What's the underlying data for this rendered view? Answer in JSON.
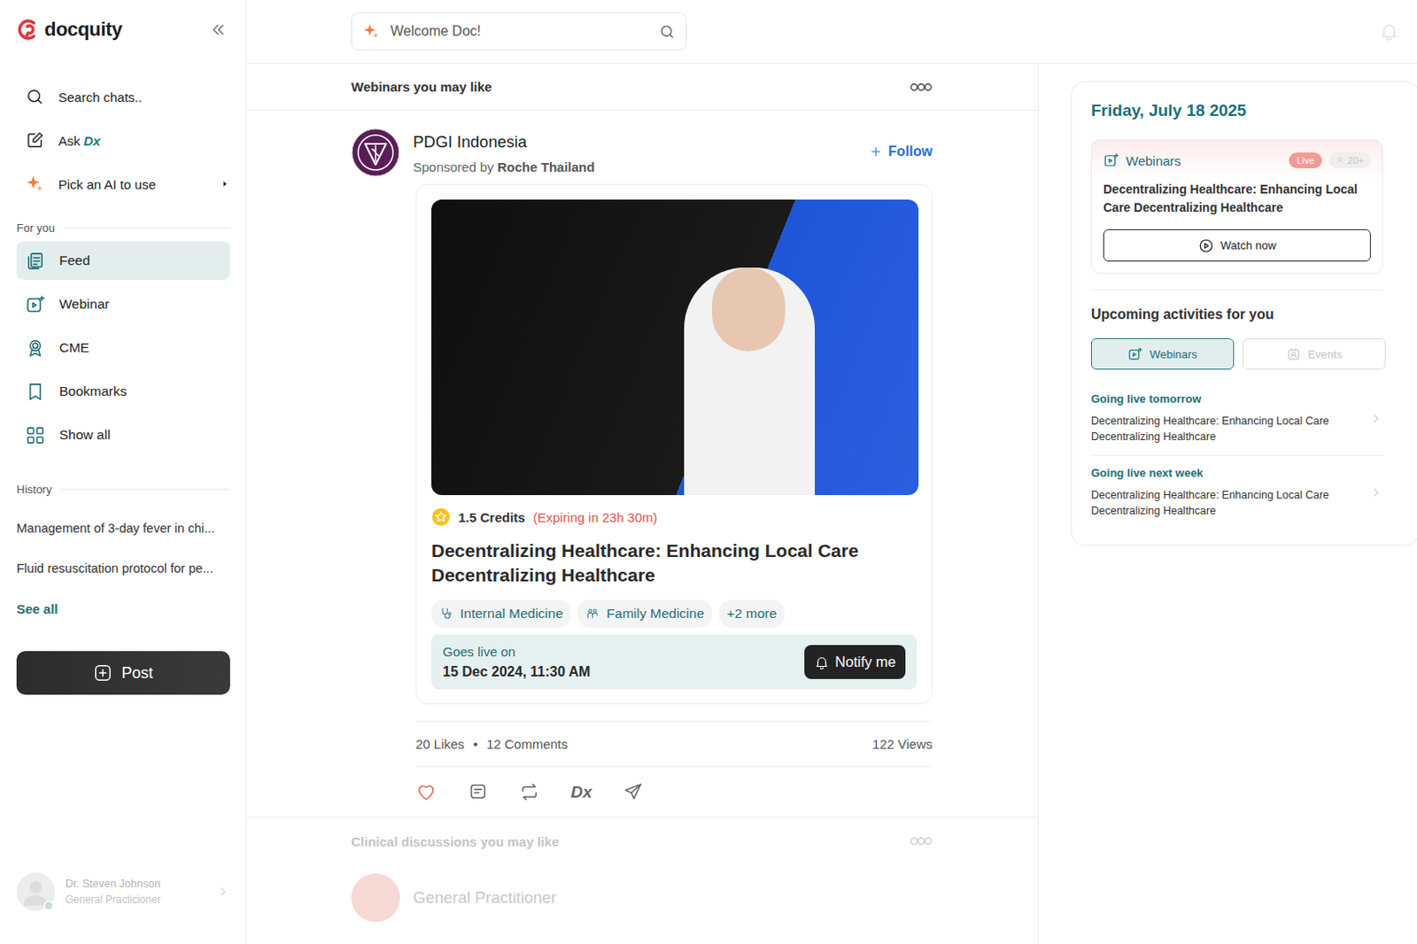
{
  "brand": {
    "name": "docquity"
  },
  "search": {
    "placeholder": "Welcome Doc!"
  },
  "sidebar": {
    "search_chats": "Search chats..",
    "ask": {
      "label": "Ask",
      "badge": "Dx"
    },
    "pick_ai": "Pick an AI to use",
    "for_you_label": "For you",
    "items": [
      {
        "label": "Feed",
        "selected": true
      },
      {
        "label": "Webinar",
        "selected": false
      },
      {
        "label": "CME",
        "selected": false
      },
      {
        "label": "Bookmarks",
        "selected": false
      },
      {
        "label": "Show all",
        "selected": false
      }
    ],
    "history_label": "History",
    "history": [
      "Management of 3-day fever in chi...",
      "Fluid resuscitation protocol for pe..."
    ],
    "see_all": "See all",
    "post_button": "Post",
    "user": {
      "name": "Dr. Steven Johnson",
      "role": "General Practicioner"
    }
  },
  "feed": {
    "section_title": "Webinars you may like",
    "post": {
      "author": "PDGI Indonesia",
      "sponsored_prefix": "Sponsored by",
      "sponsor": "Roche Thailand",
      "follow": "Follow",
      "credits": "1.5 Credits",
      "expiry": "(Expiring in 23h 30m)",
      "title": "Decentralizing Healthcare: Enhancing Local Care Decentralizing Healthcare",
      "tags": [
        {
          "label": "Internal Medicine",
          "kind": "internal"
        },
        {
          "label": "Family Medicine",
          "kind": "family"
        },
        {
          "label": "+2 more",
          "kind": "more"
        }
      ],
      "goes_live_label": "Goes live on",
      "goes_live_date": "15 Dec 2024, 11:30 AM",
      "notify": "Notify me",
      "likes": "20 Likes",
      "separator": "•",
      "comments": "12 Comments",
      "views": "122 Views",
      "dx_action": "Dx",
      "liked": false
    },
    "next_section_title": "Clinical discussions you may like",
    "next_author": "General Practitioner"
  },
  "right": {
    "date": "Friday, July 18 2025",
    "live": {
      "label": "Webinars",
      "badge": "Live",
      "count": "20+",
      "title": "Decentralizing Healthcare: Enhancing Local Care Decentralizing Healthcare",
      "watch": "Watch now"
    },
    "upcoming_title": "Upcoming activities for you",
    "tabs": [
      {
        "label": "Webinars",
        "selected": true
      },
      {
        "label": "Events",
        "selected": false
      }
    ],
    "items": [
      {
        "when": "Going live tomorrow",
        "title": "Decentralizing Healthcare: Enhancing Local Care Decentralizing Healthcare"
      },
      {
        "when": "Going live next week",
        "title": "Decentralizing Healthcare: Enhancing Local Care Decentralizing Healthcare"
      }
    ]
  }
}
